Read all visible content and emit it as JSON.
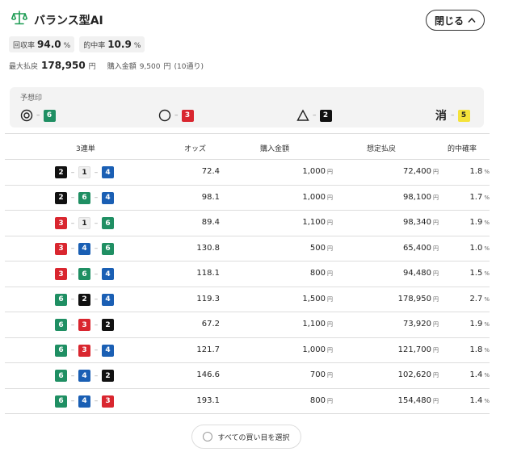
{
  "header": {
    "title": "バランス型AI",
    "logo_icon": "balance-scale-icon",
    "close_label": "閉じる"
  },
  "stats": [
    {
      "label": "回収率",
      "value": "94.0",
      "unit": "%"
    },
    {
      "label": "的中率",
      "value": "10.9",
      "unit": "%"
    }
  ],
  "payout_line": {
    "max_label": "最大払戻",
    "max_value": "178,950",
    "max_unit": "円",
    "purchase_label": "購入金額",
    "purchase_value": "9,500",
    "purchase_unit": "円",
    "count": "(10通り)"
  },
  "marks": {
    "label": "予想印",
    "items": [
      {
        "symbol": "◎",
        "name": "honmei",
        "number": "6"
      },
      {
        "symbol": "○",
        "name": "taikou",
        "number": "3"
      },
      {
        "symbol": "△",
        "name": "renshita",
        "number": "2"
      },
      {
        "symbol": "消",
        "name": "kesu",
        "number": "5"
      }
    ]
  },
  "table": {
    "headers": {
      "combo": "3連単",
      "odds": "オッズ",
      "amount": "購入金額",
      "payout": "想定払戻",
      "prob": "的中確率"
    },
    "yen": "円",
    "pct": "%",
    "rows": [
      {
        "combo": [
          "2",
          "1",
          "4"
        ],
        "odds": "72.4",
        "amount": "1,000",
        "payout": "72,400",
        "prob": "1.8"
      },
      {
        "combo": [
          "2",
          "6",
          "4"
        ],
        "odds": "98.1",
        "amount": "1,000",
        "payout": "98,100",
        "prob": "1.7"
      },
      {
        "combo": [
          "3",
          "1",
          "6"
        ],
        "odds": "89.4",
        "amount": "1,100",
        "payout": "98,340",
        "prob": "1.9"
      },
      {
        "combo": [
          "3",
          "4",
          "6"
        ],
        "odds": "130.8",
        "amount": "500",
        "payout": "65,400",
        "prob": "1.0"
      },
      {
        "combo": [
          "3",
          "6",
          "4"
        ],
        "odds": "118.1",
        "amount": "800",
        "payout": "94,480",
        "prob": "1.5"
      },
      {
        "combo": [
          "6",
          "2",
          "4"
        ],
        "odds": "119.3",
        "amount": "1,500",
        "payout": "178,950",
        "prob": "2.7"
      },
      {
        "combo": [
          "6",
          "3",
          "2"
        ],
        "odds": "67.2",
        "amount": "1,100",
        "payout": "73,920",
        "prob": "1.9"
      },
      {
        "combo": [
          "6",
          "3",
          "4"
        ],
        "odds": "121.7",
        "amount": "1,000",
        "payout": "121,700",
        "prob": "1.8"
      },
      {
        "combo": [
          "6",
          "4",
          "2"
        ],
        "odds": "146.6",
        "amount": "700",
        "payout": "102,620",
        "prob": "1.4"
      },
      {
        "combo": [
          "6",
          "4",
          "3"
        ],
        "odds": "193.1",
        "amount": "800",
        "payout": "154,480",
        "prob": "1.4"
      }
    ]
  },
  "select_all_label": "すべての買い目を選択",
  "colors": {
    "1": "#efefef",
    "2": "#111111",
    "3": "#d9262f",
    "4": "#1a5fb4",
    "5": "#f4e23a",
    "6": "#1f8f63",
    "brand": "#1f9d55"
  }
}
